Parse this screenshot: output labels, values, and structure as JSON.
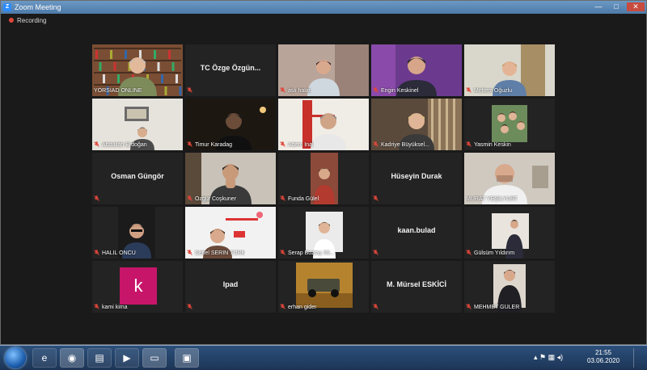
{
  "window": {
    "title": "Zoom Meeting",
    "controls": [
      "—",
      "□",
      "✕"
    ]
  },
  "recording": {
    "label": "Recording"
  },
  "colors": {
    "active_speaker": "#c4d43a",
    "mic_muted": "#e0463a",
    "avatar": "#c7166a"
  },
  "participants": [
    {
      "name": "YÖRSİAD ONLİNE",
      "video": true,
      "scene": "bookshelf-man",
      "muted": false
    },
    {
      "name": "TC Özge Özgün...",
      "video": false,
      "muted": true
    },
    {
      "name": "asli halac",
      "video": true,
      "scene": "woman-room",
      "muted": true
    },
    {
      "name": "Engin Keskinel",
      "video": true,
      "scene": "purple-man",
      "muted": true
    },
    {
      "name": "Meltem Oğuzlu",
      "video": true,
      "scene": "woman-door",
      "muted": true
    },
    {
      "name": "Abdullah Erdoğan",
      "video": true,
      "scene": "office-man",
      "muted": true
    },
    {
      "name": "Timur Karadag",
      "video": true,
      "scene": "dark-man",
      "muted": true
    },
    {
      "name": "Adem İnal",
      "video": true,
      "scene": "bridge-man",
      "muted": true
    },
    {
      "name": "Kadriye Büyüksel...",
      "video": true,
      "scene": "blonde-woman",
      "muted": true
    },
    {
      "name": "Yasmin Keskin",
      "video": true,
      "scene": "kids-photo",
      "muted": true
    },
    {
      "name": "Osman Güngör",
      "video": false,
      "muted": true
    },
    {
      "name": "Özgür Coşkuner",
      "video": true,
      "scene": "thinking-man",
      "muted": true
    },
    {
      "name": "Funda Gülel",
      "video": true,
      "scene": "woman-red",
      "muted": true
    },
    {
      "name": "Hüseyin Durak",
      "video": false,
      "muted": true
    },
    {
      "name": "MURAT YEŞİLYURT",
      "video": true,
      "scene": "bald-man",
      "muted": false,
      "active": true
    },
    {
      "name": "HALİL ÖNCÜ",
      "video": true,
      "scene": "glasses-man",
      "muted": true
    },
    {
      "name": "Sehel SERİN TÜRK",
      "video": true,
      "scene": "shelf-man",
      "muted": true
    },
    {
      "name": "Serap Boztaş 55...",
      "video": true,
      "scene": "portrait-woman",
      "muted": true
    },
    {
      "name": "kaan.bulad",
      "video": false,
      "muted": true
    },
    {
      "name": "Gülsüm Yıldırım",
      "video": true,
      "scene": "sitting-woman",
      "muted": true
    },
    {
      "name": "kami kima",
      "video": false,
      "avatar": "k",
      "muted": true
    },
    {
      "name": "Ipad",
      "video": false,
      "muted": true
    },
    {
      "name": "erhan gider",
      "video": true,
      "scene": "jeep",
      "muted": true
    },
    {
      "name": "M. Mürsel ESKİCİ",
      "video": false,
      "muted": true
    },
    {
      "name": "MEHMET GÜLER",
      "video": true,
      "scene": "suit-man",
      "muted": true
    }
  ],
  "taskbar": {
    "apps": [
      "windows-explorer-icon",
      "ie-icon",
      "chrome-icon",
      "folder-icon",
      "media-player-icon",
      "window-icon",
      "zoom-icon"
    ],
    "clock_time": "21:55",
    "clock_date": "03.06.2020"
  }
}
